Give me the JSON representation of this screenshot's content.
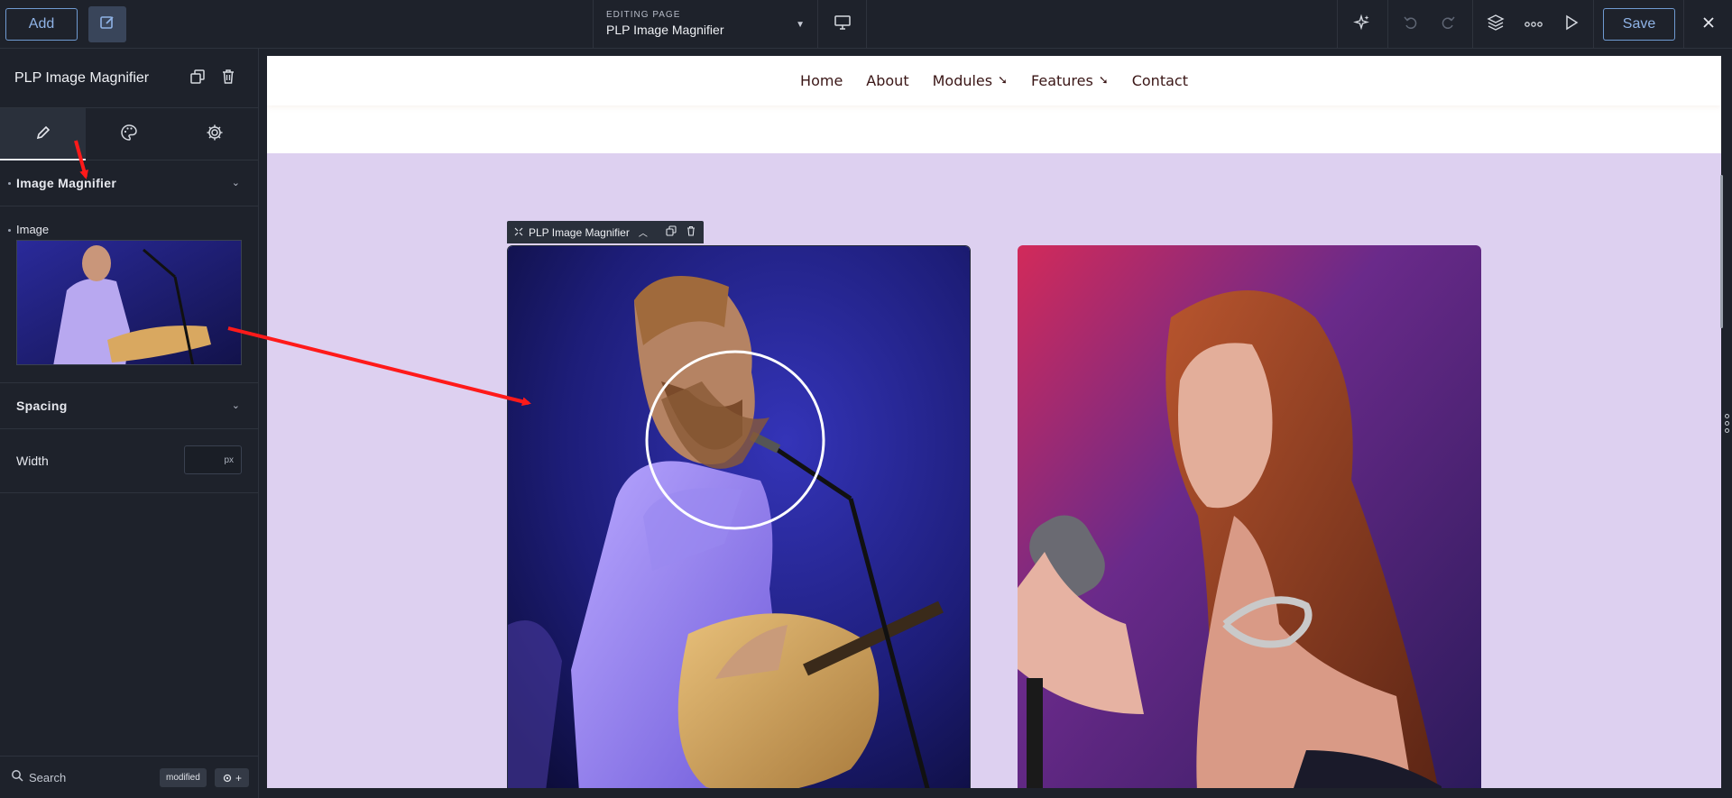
{
  "topbar": {
    "add_label": "Add",
    "editing_caption": "EDITING PAGE",
    "page_name": "PLP Image Magnifier",
    "save_label": "Save"
  },
  "panel": {
    "title": "PLP Image Magnifier",
    "section_magnifier": "Image Magnifier",
    "image_label": "Image",
    "section_spacing": "Spacing",
    "width_label": "Width",
    "width_unit": "px",
    "search_placeholder": "Search",
    "modified_badge": "modified"
  },
  "site_nav": {
    "items": [
      "Home",
      "About",
      "Modules",
      "Features",
      "Contact"
    ]
  },
  "module": {
    "label": "PLP Image Magnifier"
  },
  "colors": {
    "accent": "#8fb3e6",
    "canvas_bg": "#ddd0f0",
    "annotation": "#ff1a1a"
  },
  "icons": [
    "edit-icon",
    "desktop-icon",
    "ai-sparkle-icon",
    "undo-icon",
    "redo-icon",
    "layers-icon",
    "more-icon",
    "preview-icon",
    "close-icon",
    "copy-icon",
    "trash-icon",
    "pencil-icon",
    "palette-icon",
    "gear-icon",
    "search-icon"
  ]
}
